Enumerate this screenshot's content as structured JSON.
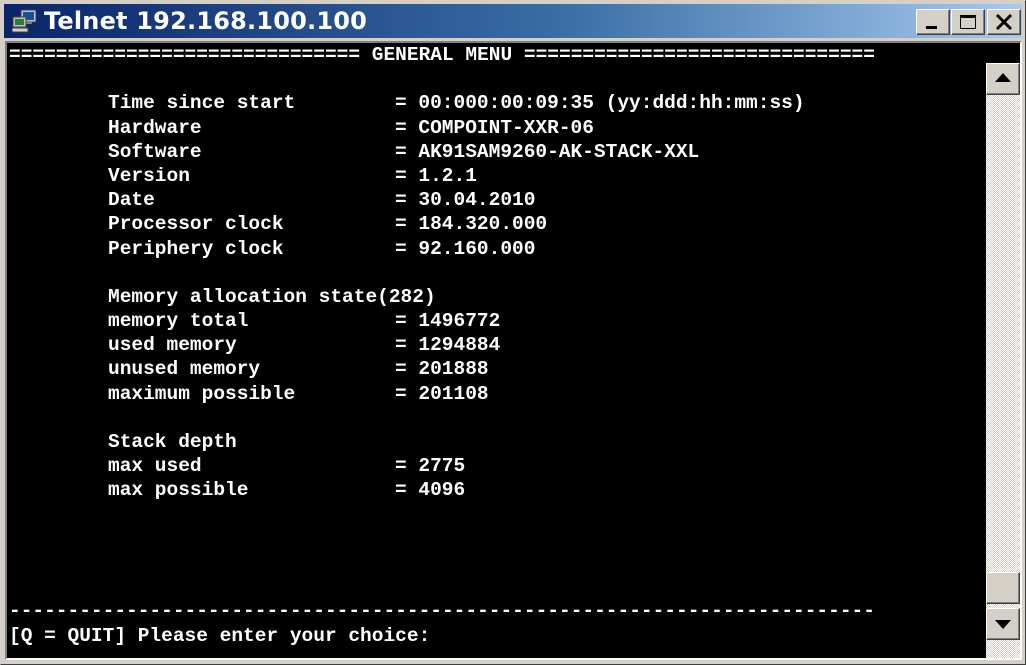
{
  "window": {
    "title": "Telnet 192.168.100.100",
    "icon": "telnet-computer-icon",
    "controls": [
      "minimize-icon",
      "maximize-icon",
      "close-icon"
    ]
  },
  "terminal": {
    "header": "============================== GENERAL MENU ==============================",
    "lines": [
      {
        "label": "Time since start",
        "value": "= 00:000:00:09:35 (yy:ddd:hh:mm:ss)"
      },
      {
        "label": "Hardware",
        "value": "= COMPOINT-XXR-06"
      },
      {
        "label": "Software",
        "value": "= AK91SAM9260-AK-STACK-XXL"
      },
      {
        "label": "Version",
        "value": "= 1.2.1"
      },
      {
        "label": "Date",
        "value": "= 30.04.2010"
      },
      {
        "label": "Processor clock",
        "value": "= 184.320.000"
      },
      {
        "label": "Periphery clock",
        "value": "= 92.160.000"
      }
    ],
    "memory_title": "Memory allocation state(282)",
    "memory_lines": [
      {
        "label": "memory total",
        "value": "= 1496772"
      },
      {
        "label": "used memory",
        "value": "= 1294884"
      },
      {
        "label": "unused memory",
        "value": "= 201888"
      },
      {
        "label": "maximum possible",
        "value": "= 201108"
      }
    ],
    "stack_title": "Stack depth",
    "stack_lines": [
      {
        "label": "max used",
        "value": "= 2775"
      },
      {
        "label": "max possible",
        "value": "= 4096"
      }
    ],
    "footer_rule": "--------------------------------------------------------------------------",
    "prompt": "[Q = QUIT] Please enter your choice:"
  },
  "scrollbar": {
    "up_icon": "scroll-up-arrow-icon",
    "down_icon": "scroll-down-arrow-icon"
  }
}
